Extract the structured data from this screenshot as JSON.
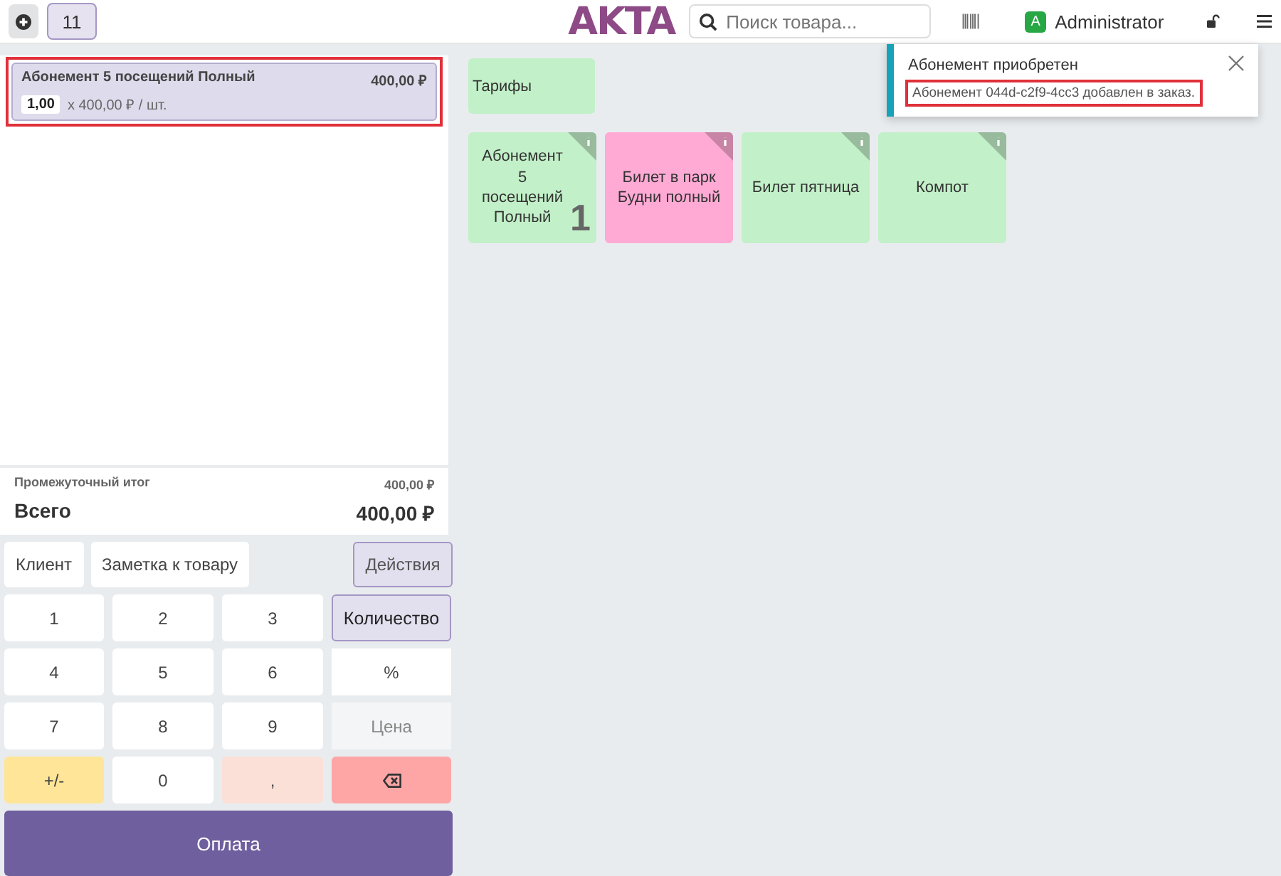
{
  "header": {
    "new_order_label": "11",
    "logo": "AKTA",
    "search": {
      "placeholder": "Поиск товара..."
    },
    "user": {
      "initial": "A",
      "name": "Administrator"
    }
  },
  "order": {
    "lines": [
      {
        "name": "Абонемент 5 посещений Полный",
        "price": "400,00 ₽",
        "quantity": "1,00",
        "unit_price": "x 400,00 ₽ / шт.",
        "selected": true,
        "highlighted": true
      }
    ],
    "subtotal_label": "Промежуточный итог",
    "subtotal": "400,00 ₽",
    "total_label": "Всего",
    "total": "400,00 ₽"
  },
  "actions": [
    {
      "label": "Клиент",
      "selected": false
    },
    {
      "label": "Заметка к товару",
      "selected": false
    }
  ],
  "actions_menu": {
    "label": "Действия"
  },
  "numpad": [
    {
      "kind": "digit",
      "label": "1"
    },
    {
      "kind": "digit",
      "label": "2"
    },
    {
      "kind": "digit",
      "label": "3"
    },
    {
      "kind": "mode",
      "label": "Количество",
      "selected": true,
      "disabled": false
    },
    {
      "kind": "digit",
      "label": "4"
    },
    {
      "kind": "digit",
      "label": "5"
    },
    {
      "kind": "digit",
      "label": "6"
    },
    {
      "kind": "mode",
      "label": "%",
      "selected": false,
      "disabled": false
    },
    {
      "kind": "digit",
      "label": "7"
    },
    {
      "kind": "digit",
      "label": "8"
    },
    {
      "kind": "digit",
      "label": "9"
    },
    {
      "kind": "mode",
      "label": "Цена",
      "selected": false,
      "disabled": true
    },
    {
      "kind": "sign",
      "label": "+/-"
    },
    {
      "kind": "digit",
      "label": "0"
    },
    {
      "kind": "decimal",
      "label": ","
    },
    {
      "kind": "backspace"
    }
  ],
  "pay_button": "Оплата",
  "categories": [
    {
      "label": "Тарифы",
      "color": "#c2f0c8"
    }
  ],
  "products": [
    {
      "name": "Абонемент 5 посещений Полный",
      "color": "#c2f0c8",
      "count": "1"
    },
    {
      "name": "Билет в парк Будни полный",
      "color": "#ffaad4"
    },
    {
      "name": "Билет пятница",
      "color": "#c2f0c8"
    },
    {
      "name": "Компот",
      "color": "#c2f0c8"
    }
  ],
  "notification": {
    "title": "Абонемент приобретен",
    "message": "Абонемент 044d-c2f9-4cc3 добавлен в заказ.",
    "highlighted": true
  }
}
